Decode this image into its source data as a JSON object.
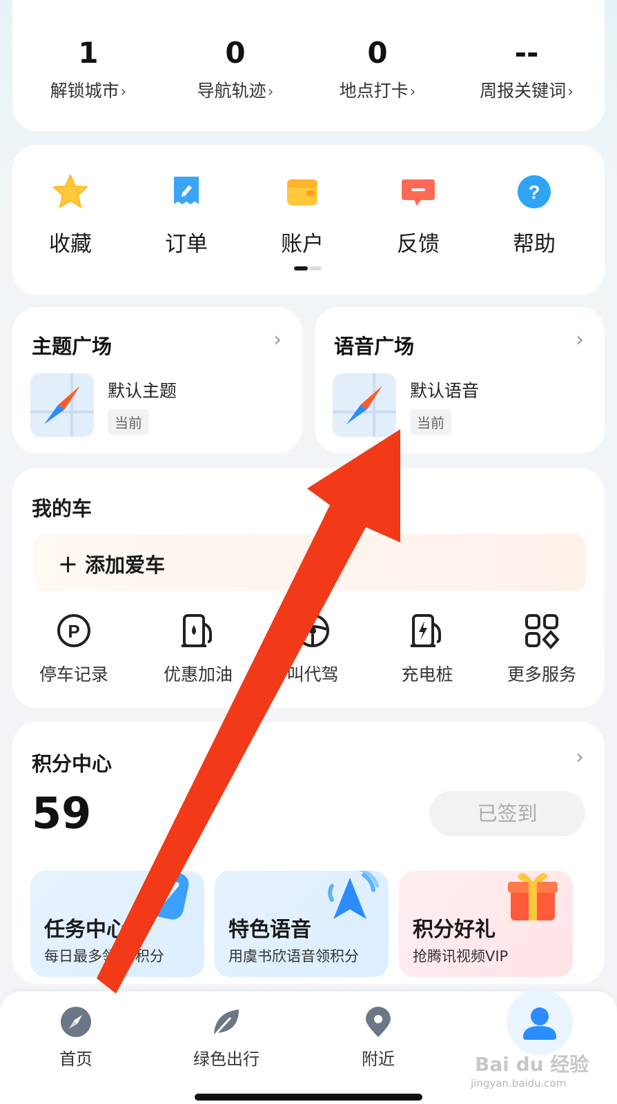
{
  "stats": [
    {
      "value": "1",
      "label": "解锁城市",
      "chevron": "›"
    },
    {
      "value": "0",
      "label": "导航轨迹",
      "chevron": "›"
    },
    {
      "value": "0",
      "label": "地点打卡",
      "chevron": "›"
    },
    {
      "value": "--",
      "label": "周报关键词",
      "chevron": "›"
    }
  ],
  "quick_actions": [
    {
      "label": "收藏",
      "icon": "star-icon"
    },
    {
      "label": "订单",
      "icon": "order-icon"
    },
    {
      "label": "账户",
      "icon": "wallet-icon"
    },
    {
      "label": "反馈",
      "icon": "feedback-icon"
    },
    {
      "label": "帮助",
      "icon": "help-icon"
    }
  ],
  "theme": {
    "title": "主题广场",
    "chevron": "›",
    "item_name": "默认主题",
    "badge": "当前"
  },
  "voice": {
    "title": "语音广场",
    "chevron": "›",
    "item_name": "默认语音",
    "badge": "当前"
  },
  "car": {
    "title": "我的车",
    "add_label": "＋ 添加爱车",
    "services": [
      {
        "label": "停车记录",
        "icon": "parking-icon"
      },
      {
        "label": "优惠加油",
        "icon": "fuel-icon"
      },
      {
        "label": "叫代驾",
        "icon": "driver-icon"
      },
      {
        "label": "充电桩",
        "icon": "charging-icon"
      },
      {
        "label": "更多服务",
        "icon": "more-services-icon"
      }
    ]
  },
  "points": {
    "title": "积分中心",
    "chevron": "›",
    "value": "59",
    "signin_label": "已签到",
    "promos": [
      {
        "title": "任务中心",
        "subtitle": "每日最多领50积分",
        "icon": "task-icon"
      },
      {
        "title": "特色语音",
        "subtitle": "用虞书欣语音领积分",
        "icon": "voice-navigation-icon"
      },
      {
        "title": "积分好礼",
        "subtitle": "抢腾讯视频VIP",
        "icon": "gift-icon"
      }
    ]
  },
  "bottom_nav": [
    {
      "label": "首页",
      "icon": "compass-icon"
    },
    {
      "label": "绿色出行",
      "icon": "leaf-icon"
    },
    {
      "label": "附近",
      "icon": "location-pin-icon"
    },
    {
      "label": "",
      "icon": "user-icon"
    }
  ],
  "watermark": {
    "brand": "Bai du 经验",
    "url": "jingyan.baidu.com"
  },
  "colors": {
    "accent_blue": "#2b8cff",
    "annotation_red": "#f23a18",
    "star_yellow": "#ffc83d",
    "feedback_red": "#ff6a55"
  }
}
